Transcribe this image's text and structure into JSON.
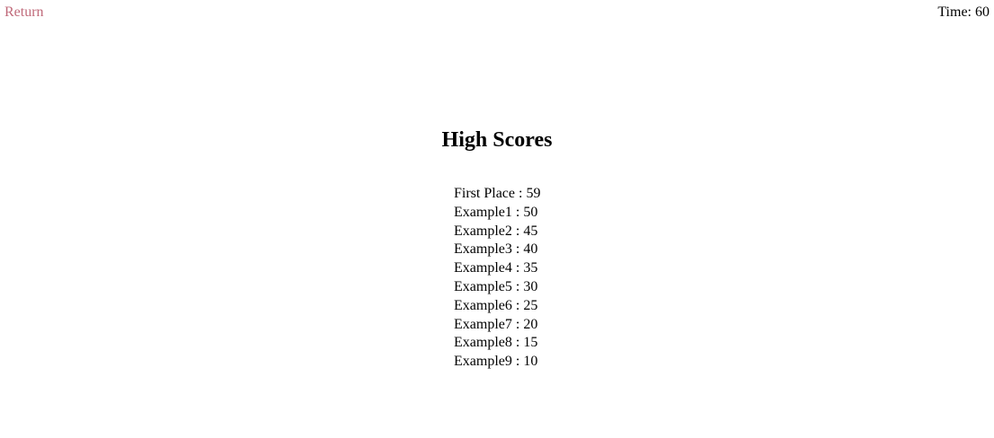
{
  "header": {
    "return_label": "Return",
    "timer_label": "Time:",
    "timer_value": "60",
    "colors": {
      "link": "#c06a7a",
      "text": "#000000",
      "background": "#ffffff"
    }
  },
  "scores": {
    "title": "High Scores",
    "separator": " : ",
    "entries": [
      {
        "name": "First Place",
        "score": "59"
      },
      {
        "name": "Example1",
        "score": "50"
      },
      {
        "name": "Example2",
        "score": "45"
      },
      {
        "name": "Example3",
        "score": "40"
      },
      {
        "name": "Example4",
        "score": "35"
      },
      {
        "name": "Example5",
        "score": "30"
      },
      {
        "name": "Example6",
        "score": "25"
      },
      {
        "name": "Example7",
        "score": "20"
      },
      {
        "name": "Example8",
        "score": "15"
      },
      {
        "name": "Example9",
        "score": "10"
      }
    ]
  }
}
